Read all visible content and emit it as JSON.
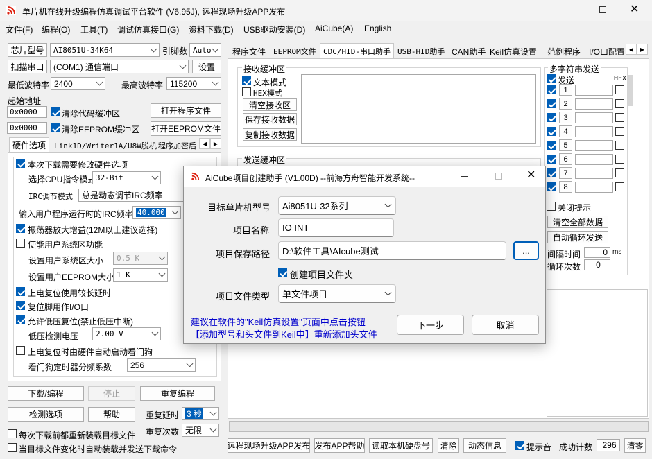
{
  "window": {
    "title": "单片机在线升级编程仿真调试平台软件 (V6.95J), 远程现场升级APP发布"
  },
  "menu": [
    "文件(F)",
    "编程(O)",
    "工具(T)",
    "调试仿真接口(G)",
    "资料下载(D)",
    "USB驱动安装(D)",
    "AiCube(A)",
    "English"
  ],
  "left": {
    "chip_label": "芯片型号",
    "chip_value": "AI8051U-34K64",
    "pins_label": "引脚数",
    "pins_value": "Auto",
    "scan_label": "扫描串口",
    "port_value": "(COM1) 通信端口",
    "settings_label": "设置",
    "min_baud_label": "最低波特率",
    "min_baud_value": "2400",
    "max_baud_label": "最高波特率",
    "max_baud_value": "115200",
    "start_addr_label": "起始地址",
    "addr1": "0x0000",
    "clear_code_label": "清除代码缓冲区",
    "open_prog_label": "打开程序文件",
    "addr2": "0x0000",
    "clear_eeprom_label": "清除EEPROM缓冲区",
    "open_eeprom_label": "打开EEPROM文件",
    "tabs": [
      "硬件选项",
      "Link1D/Writer1A/U8W脱机",
      "程序加密后"
    ],
    "hw": {
      "modify_hw": "本次下载需要修改硬件选项",
      "cpu_mode_label": "选择CPU指令模式",
      "cpu_mode_value": "32-Bit",
      "irc_mode_label": "IRC调节模式",
      "irc_mode_value": "总是动态调节IRC频率",
      "irc_freq_label": "输入用户程序运行时的IRC频率",
      "irc_freq_value": "40.000",
      "osc_gain": "振荡器放大增益(12M以上建议选择)",
      "user_sys_area": "使能用户系统区功能",
      "sys_size_label": "设置用户系统区大小",
      "sys_size_value": "0.5 K",
      "eeprom_size_label": "设置用户EEPROM大小",
      "eeprom_size_value": "1 K",
      "power_delay": "上电复位使用较长延时",
      "reset_io": "复位脚用作I/O口",
      "lvr": "允许低压复位(禁止低压中断)",
      "lvd_label": "低压检测电压",
      "lvd_value": "2.00 V",
      "wdt_auto": "上电复位时由硬件自动启动看门狗",
      "wdt_div_label": "看门狗定时器分频系数",
      "wdt_div_value": "256"
    },
    "download_label": "下载/编程",
    "stop_label": "停止",
    "reprog_label": "重复编程",
    "check_label": "检测选项",
    "help_label": "帮助",
    "repeat_delay_label": "重复延时",
    "repeat_delay_value": "3 秒",
    "repeat_count_label": "重复次数",
    "repeat_count_value": "无限",
    "reload_label": "每次下载前都重新装载目标文件",
    "auto_send_label": "当目标文件变化时自动装载并发送下载命令"
  },
  "right": {
    "tabs": [
      "程序文件",
      "EEPROM文件",
      "CDC/HID-串口助手",
      "USB-HID助手",
      "CAN助手",
      "Keil仿真设置",
      "范例程序",
      "I/O口配置"
    ],
    "recv_group": "接收缓冲区",
    "text_mode": "文本模式",
    "hex_mode": "HEX模式",
    "clear_recv": "清空接收区",
    "save_recv": "保存接收数据",
    "copy_recv": "复制接收数据",
    "send_group": "发送缓冲区",
    "multi_group": "多字符串发送",
    "send_col": "发送",
    "hex_col": "HEX",
    "rows": [
      "1",
      "2",
      "3",
      "4",
      "5",
      "6",
      "7",
      "8"
    ],
    "close_tip": "关闭提示",
    "clear_all": "清空全部数据",
    "auto_loop": "自动循环发送",
    "interval_label": "间隔时间",
    "interval_value": "0",
    "interval_unit": "ms",
    "loop_label": "循环次数",
    "loop_value": "0"
  },
  "status": {
    "publish": "远程现场升级APP发布",
    "publish_help": "发布APP帮助",
    "read_disk": "读取本机硬盘号",
    "clear": "清除",
    "dynamic": "动态信息",
    "beep": "提示音",
    "success_label": "成功计数",
    "success_value": "296",
    "clear2": "清零"
  },
  "dialog": {
    "title": "AiCube项目创建助手 (V1.00D) --前海方舟智能开发系统--",
    "mcu_label": "目标单片机型号",
    "mcu_value": "Ai8051U-32系列",
    "name_label": "项目名称",
    "name_value": "IO INT",
    "path_label": "项目保存路径",
    "path_value": "D:\\软件工具\\AIcube测试",
    "browse": "...",
    "create_folder": "创建项目文件夹",
    "type_label": "项目文件类型",
    "type_value": "单文件项目",
    "hint1": "建议在软件的\"Keil仿真设置\"页面中点击按钮",
    "hint2": "【添加型号和头文件到Keil中】重新添加头文件",
    "next": "下一步",
    "cancel": "取消",
    "accent": "#005fb8",
    "hint_color": "#0000cc"
  }
}
